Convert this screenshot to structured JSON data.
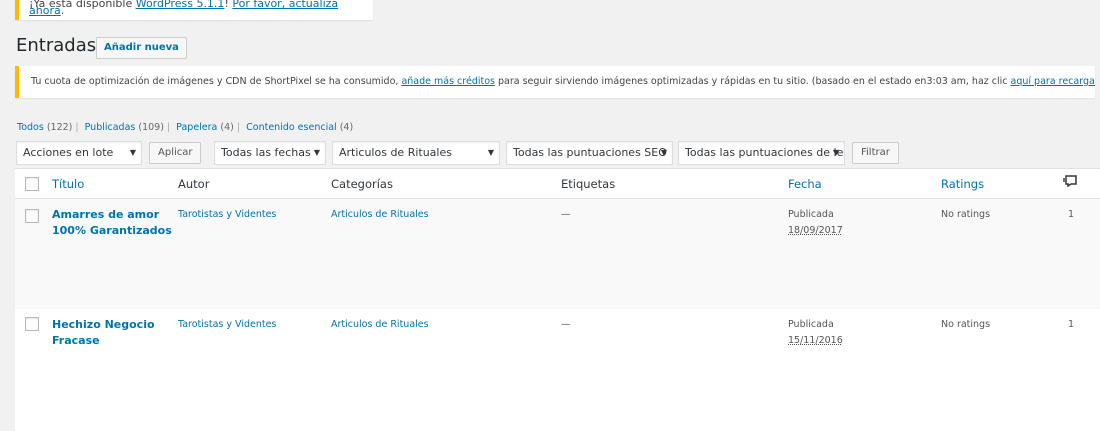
{
  "update_nag": {
    "text_before": "¡Ya está disponible ",
    "version_link": "WordPress 5.1.1",
    "text_mid": "! ",
    "update_link": "Por favor, actualiza ahora",
    "text_after": "."
  },
  "page": {
    "title": "Entradas",
    "add_new_label": "Añadir nueva"
  },
  "notice": {
    "text1": "Tu cuota de optimización de imágenes y CDN de ShortPixel se ha consumido, ",
    "link1": "añade más créditos",
    "text2": " para seguir sirviendo imágenes optimizadas y rápidas en tu sitio. (basado en el estado en3:03 am, haz clic ",
    "link2": "aquí para recargar",
    "text3": ")."
  },
  "views": [
    {
      "label": "Todos",
      "count": "(122)"
    },
    {
      "label": "Publicadas",
      "count": "(109)"
    },
    {
      "label": "Papelera",
      "count": "(4)"
    },
    {
      "label": "Contenido esencial",
      "count": "(4)"
    }
  ],
  "filters": {
    "bulk_actions": "Acciones en lote",
    "apply_label": "Aplicar",
    "dates": "Todas las fechas",
    "category": "Articulos de Rituales",
    "seo_scores": "Todas las puntuaciones SEO",
    "readability_scores": "Todas las puntuaciones de legibilidad",
    "filter_label": "Filtrar"
  },
  "columns": {
    "title": "Título",
    "author": "Autor",
    "categories": "Categorías",
    "tags": "Etiquetas",
    "date": "Fecha",
    "ratings": "Ratings"
  },
  "rows": [
    {
      "title_line1": "Amarres de amor",
      "title_line2": "100% Garantizados",
      "author": "Tarotistas y Videntes",
      "category": "Articulos de Rituales",
      "tags": "—",
      "status": "Publicada",
      "date": "18/09/2017",
      "ratings": "No ratings",
      "comments": "1"
    },
    {
      "title_line1": "Hechizo Negocio",
      "title_line2": "Fracase",
      "author": "Tarotistas y Videntes",
      "category": "Articulos de Rituales",
      "tags": "—",
      "status": "Publicada",
      "date": "15/11/2016",
      "ratings": "No ratings",
      "comments": "1"
    }
  ]
}
